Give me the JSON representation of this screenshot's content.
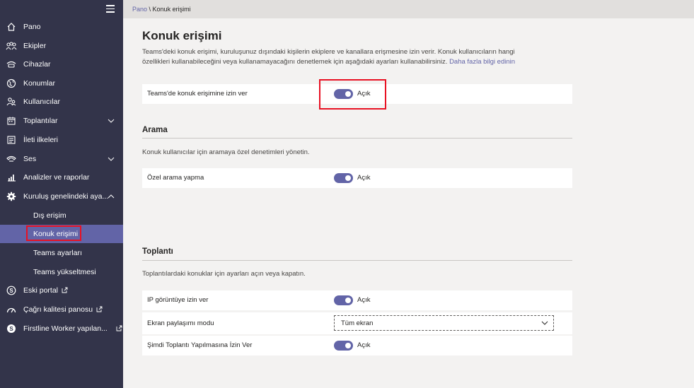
{
  "breadcrumb": {
    "home": "Pano",
    "separator": " \\ ",
    "current": "Konuk erişimi"
  },
  "sidebar": {
    "items": [
      {
        "label": "Pano",
        "icon": "home-icon"
      },
      {
        "label": "Ekipler",
        "icon": "teams-icon"
      },
      {
        "label": "Cihazlar",
        "icon": "devices-icon"
      },
      {
        "label": "Konumlar",
        "icon": "globe-icon"
      },
      {
        "label": "Kullanıcılar",
        "icon": "users-icon"
      },
      {
        "label": "Toplantılar",
        "icon": "calendar-icon"
      },
      {
        "label": "İleti ilkeleri",
        "icon": "message-policy-icon"
      },
      {
        "label": "Ses",
        "icon": "phone-icon"
      },
      {
        "label": "Analizler ve raporlar",
        "icon": "analytics-icon"
      },
      {
        "label": "Kuruluş genelindeki aya...",
        "icon": "gear-icon"
      },
      {
        "label": "Dış erişim"
      },
      {
        "label": "Konuk erişimi"
      },
      {
        "label": "Teams ayarları"
      },
      {
        "label": "Teams yükseltmesi"
      },
      {
        "label": "Eski portal",
        "icon": "skype-icon"
      },
      {
        "label": "Çağrı kalitesi panosu",
        "icon": "call-quality-icon"
      },
      {
        "label": "Firstline Worker yapılan...",
        "icon": "skype-icon"
      }
    ]
  },
  "page": {
    "title": "Konuk erişimi",
    "description": "Teams'deki konuk erişimi, kuruluşunuz dışındaki kişilerin ekiplere ve kanallara erişmesine izin verir. Konuk kullanıcıların hangi özellikleri kullanabileceğini veya kullanamayacağını denetlemek için aşağıdaki ayarları kullanabilirsiniz.",
    "learn_more": "Daha fazla bilgi edinin"
  },
  "guest_access": {
    "label": "Teams'de konuk erişimine izin ver",
    "state": "Açık"
  },
  "calling": {
    "title": "Arama",
    "description": "Konuk kullanıcılar için aramaya özel denetimleri yönetin.",
    "private_call": {
      "label": "Özel arama yapma",
      "state": "Açık"
    }
  },
  "meeting": {
    "title": "Toplantı",
    "description": "Toplantılardaki konuklar için ayarları açın veya kapatın.",
    "ip_video": {
      "label": "IP görüntüye izin ver",
      "state": "Açık"
    },
    "screen_sharing": {
      "label": "Ekran paylaşımı modu",
      "value": "Tüm ekran"
    },
    "meet_now": {
      "label": "Şimdi Toplantı Yapılmasına İzin Ver",
      "state": "Açık"
    }
  },
  "colors": {
    "sidebar": "#33344a",
    "accent": "#6264a7",
    "highlight": "#e81123"
  }
}
